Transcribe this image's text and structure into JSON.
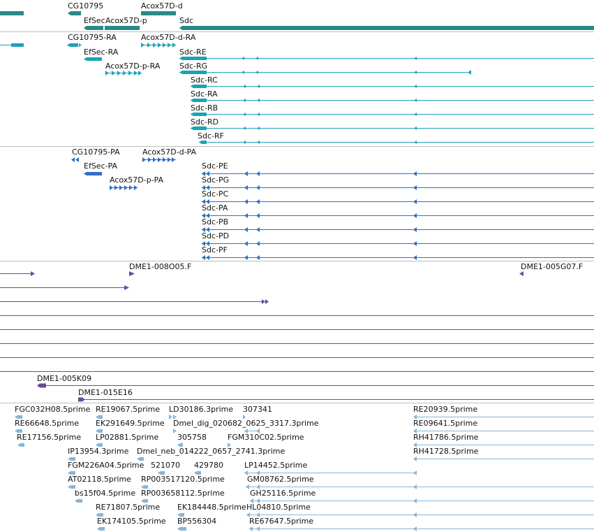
{
  "colors": {
    "gene": "#2a8a8a",
    "mrna": "#1aa3b8",
    "protein": "#2f6fc4",
    "clone": "#6a4aa0",
    "est": "#86b6da",
    "divider": "#bdbdbd"
  },
  "tracks": {
    "genes": {
      "labels": [
        "CG10795",
        "Acox57D-d",
        "EfSec",
        "Acox57D-p",
        "Sdc"
      ]
    },
    "transcripts": {
      "labels": [
        "CG10795-RA",
        "Acox57D-d-RA",
        "EfSec-RA",
        "Acox57D-p-RA",
        "Sdc-RE",
        "Sdc-RG",
        "Sdc-RC",
        "Sdc-RA",
        "Sdc-RB",
        "Sdc-RD",
        "Sdc-RF"
      ]
    },
    "proteins": {
      "labels": [
        "CG10795-PA",
        "Acox57D-d-PA",
        "EfSec-PA",
        "Acox57D-p-PA",
        "Sdc-PE",
        "Sdc-PG",
        "Sdc-PC",
        "Sdc-PA",
        "Sdc-PB",
        "Sdc-PD",
        "Sdc-PF"
      ]
    },
    "clones": {
      "labels": [
        "DME1-008O05.F",
        "DME1-005G07.F",
        "DME1-005K09",
        "DME1-015E16"
      ]
    },
    "ests": {
      "labels": [
        "FGC032H08.5prime",
        "RE19067.5prime",
        "LD30186.3prime",
        "307341",
        "RE20939.5prime",
        "RE66648.5prime",
        "EK291649.5prime",
        "Dmel_dig_020682_0625_3317.3prime",
        "RE09641.5prime",
        "RE17156.5prime",
        "LP02881.5prime",
        "305758",
        "FGM310C02.5prime",
        "RH41786.5prime",
        "IP13954.3prime",
        "Dmel_neb_014222_0657_2741.3prime",
        "RH41728.5prime",
        "FGM226A04.5prime",
        "521070",
        "429780",
        "LP14452.5prime",
        "AT02118.5prime",
        "RP003517120.5prime",
        "GM08762.5prime",
        "bs15f04.5prime",
        "RP003658112.5prime",
        "GH25116.5prime",
        "RE71807.5prime",
        "EK184448.5prime",
        "HL04810.5prime",
        "EK174105.5prime",
        "BP556304",
        "RE67647.5prime"
      ]
    }
  }
}
